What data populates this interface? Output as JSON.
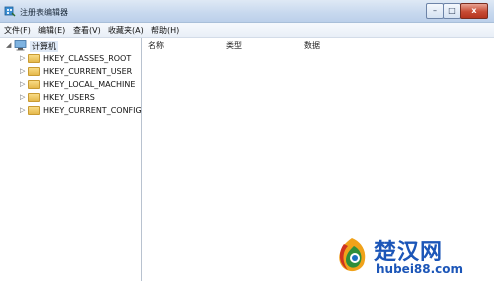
{
  "window": {
    "title": "注册表编辑器"
  },
  "caption_buttons": {
    "minimize": "–",
    "maximize": "□",
    "close": "x"
  },
  "menu": [
    "文件(F)",
    "编辑(E)",
    "查看(V)",
    "收藏夹(A)",
    "帮助(H)"
  ],
  "tree": {
    "root": "计算机",
    "items": [
      "HKEY_CLASSES_ROOT",
      "HKEY_CURRENT_USER",
      "HKEY_LOCAL_MACHINE",
      "HKEY_USERS",
      "HKEY_CURRENT_CONFIG"
    ]
  },
  "list": {
    "columns": [
      "名称",
      "类型",
      "数据"
    ]
  },
  "watermark": {
    "brand": "楚汉网",
    "url": "hubei88.com"
  }
}
